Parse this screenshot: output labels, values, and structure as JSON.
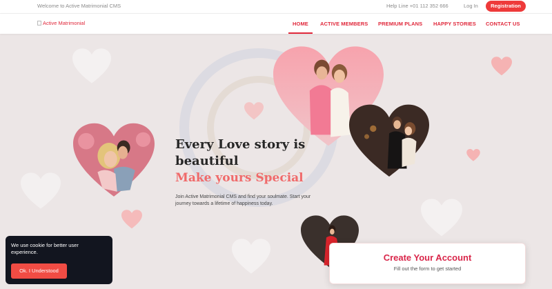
{
  "topbar": {
    "welcome": "Welcome to Active Matrimonial CMS",
    "helpline": "Help Line +01 112 352 666",
    "login": "Log In",
    "registration": "Registration"
  },
  "navbar": {
    "logo_alt": "Active Matrimonial",
    "items": [
      "HOME",
      "ACTIVE MEMBERS",
      "PREMIUM PLANS",
      "HAPPY STORIES",
      "CONTACT US"
    ],
    "active_index": 0
  },
  "hero": {
    "title": "Every Love story is beautiful",
    "highlight": "Make yours Special",
    "description": "Join Active Matrimonial CMS and find your soulmate. Start your journey towards a lifetime of happiness today."
  },
  "cookie": {
    "message": "We use cookie for better user experience.",
    "button": "Ok. I Understood"
  },
  "account_card": {
    "title": "Create Your Account",
    "subtitle": "Fill out the form to get started"
  },
  "colors": {
    "accent": "#e0273a",
    "highlight": "#f06a6a",
    "button": "#ee3a3a",
    "cookie_bg": "#12151f"
  }
}
